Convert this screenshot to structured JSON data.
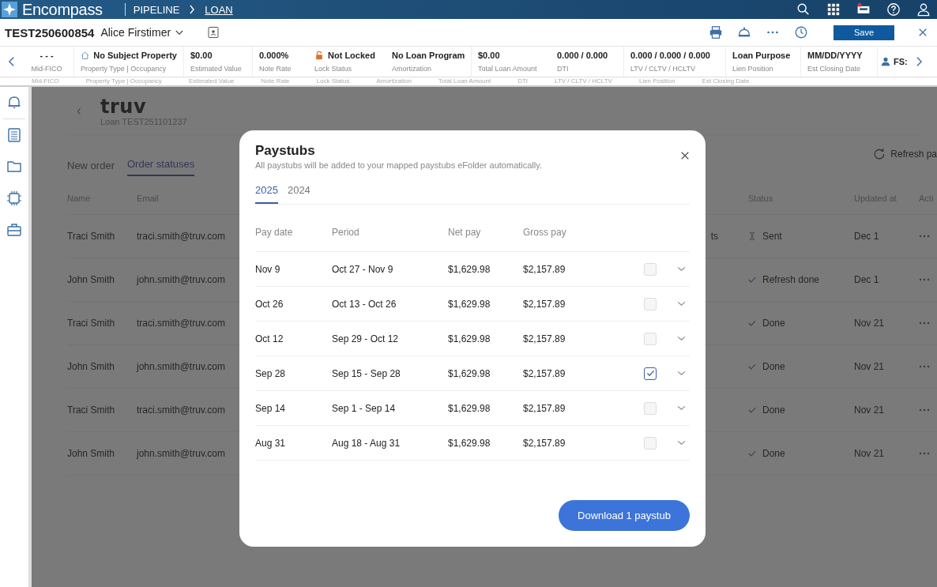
{
  "topbar": {
    "brand": "Encompass",
    "breadcrumbs": [
      {
        "label": "PIPELINE",
        "selected": false
      },
      {
        "label": "LOAN",
        "selected": true
      }
    ]
  },
  "loan_header": {
    "loan_number": "TEST250600854",
    "borrower": "Alice Firstimer",
    "save": "Save"
  },
  "info_strip": {
    "items": [
      {
        "kind": "plain",
        "value": "- - -",
        "label": "Mid-FICO"
      },
      {
        "kind": "home",
        "value": "No Subject Property",
        "label": "Property Type | Occupancy"
      },
      {
        "kind": "plain",
        "value": "$0.00",
        "label": "Estimated Value"
      },
      {
        "kind": "plain",
        "value": "0.000%",
        "label": "Note Rate"
      },
      {
        "kind": "lock",
        "value": "Not Locked",
        "label": "Lock Status"
      },
      {
        "kind": "plain",
        "value": "No Loan Program",
        "label": "Amortization"
      },
      {
        "kind": "plain",
        "value": "$0.00",
        "label": "Total Loan Amount"
      },
      {
        "kind": "plain",
        "value": "0.000 / 0.000",
        "label": "DTI"
      },
      {
        "kind": "plain",
        "value": "0.000 / 0.000 / 0.000",
        "label": "LTV / CLTV / HCLTV"
      },
      {
        "kind": "plain",
        "value": "Loan Purpose",
        "label": "Lien Position"
      },
      {
        "kind": "plain",
        "value": "MM/DD/YYYY",
        "label": "Est Closing Date"
      }
    ],
    "fs": "FS:",
    "ghost_labels": [
      "Mid-FICO",
      "Property Type | Occupancy",
      "Estimated Value",
      "Note Rate",
      "Lock Status",
      "Amortization",
      "Total Loan Amount",
      "DTI",
      "LTV / CLTV / HCLTV",
      "Lien Position",
      "Est Closing Date"
    ]
  },
  "sidebar": {
    "items": [
      {
        "kind": "bell",
        "selected": true
      },
      {
        "kind": "list",
        "selected": false
      },
      {
        "kind": "folder",
        "selected": false
      },
      {
        "kind": "chip",
        "selected": false
      },
      {
        "kind": "briefcase",
        "selected": false
      }
    ]
  },
  "truv": {
    "logo": "truv",
    "loan": "Loan TEST251101237",
    "tabs": [
      {
        "label": "New order",
        "selected": false
      },
      {
        "label": "Order statuses",
        "selected": true
      }
    ],
    "refresh": "Refresh pa",
    "columns": [
      "Name",
      "Email",
      "Status",
      "Updated at",
      "Acti"
    ],
    "rows": [
      {
        "name": "Traci Smith",
        "email": "traci.smith@truv.com",
        "column_3": "ts",
        "kind": "pending",
        "status": "Sent",
        "updated": "Dec 1"
      },
      {
        "name": "John Smith",
        "email": "john.smith@truv.com",
        "kind": "done",
        "status": "Refresh done",
        "updated": "Dec 1"
      },
      {
        "name": "Traci Smith",
        "email": "traci.smith@truv.com",
        "kind": "done",
        "status": "Done",
        "updated": "Nov 21"
      },
      {
        "name": "John Smith",
        "email": "john.smith@truv.com",
        "kind": "done",
        "status": "Done",
        "updated": "Nov 21"
      },
      {
        "name": "Traci Smith",
        "email": "traci.smith@truv.com",
        "kind": "done",
        "status": "Done",
        "updated": "Nov 21"
      },
      {
        "name": "John Smith",
        "email": "john.smith@truv.com",
        "kind": "done",
        "status": "Done",
        "updated": "Nov 21"
      }
    ]
  },
  "dialog": {
    "title": "Paystubs",
    "subtitle": "All paystubs will be added to your mapped paystubs eFolder automatically.",
    "tabs": [
      {
        "label": "2025",
        "selected": true
      },
      {
        "label": "2024",
        "selected": false
      }
    ],
    "columns": [
      "Pay date",
      "Period",
      "Net pay",
      "Gross pay"
    ],
    "rows": [
      {
        "pay_date": "Nov 9",
        "period": "Oct 27 - Nov 9",
        "net": "$1,629.98",
        "gross": "$2,157.89",
        "checked": false
      },
      {
        "pay_date": "Oct 26",
        "period": "Oct 13 - Oct 26",
        "net": "$1,629.98",
        "gross": "$2,157.89",
        "checked": false
      },
      {
        "pay_date": "Oct 12",
        "period": "Sep 29 - Oct 12",
        "net": "$1,629.98",
        "gross": "$2,157.89",
        "checked": false
      },
      {
        "pay_date": "Sep 28",
        "period": "Sep 15 - Sep 28",
        "net": "$1,629.98",
        "gross": "$2,157.89",
        "checked": true
      },
      {
        "pay_date": "Sep 14",
        "period": "Sep 1 - Sep 14",
        "net": "$1,629.98",
        "gross": "$2,157.89",
        "checked": false
      },
      {
        "pay_date": "Aug 31",
        "period": "Aug 18 - Aug 31",
        "net": "$1,629.98",
        "gross": "$2,157.89",
        "checked": false
      }
    ],
    "download": "Download 1 paystub"
  }
}
